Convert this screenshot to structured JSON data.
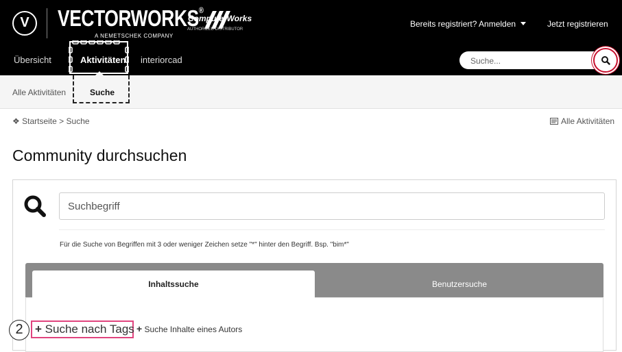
{
  "header": {
    "logo_glyph": "V",
    "brand_name": "VECTORWORKS",
    "brand_registered": "®",
    "brand_tagline": "A NEMETSCHEK COMPANY",
    "distributor_name": "ComputerWorks",
    "distributor_tagline": "AUTHORIZED DISTRIBUTOR",
    "login_label": "Bereits registriert? Anmelden",
    "register_label": "Jetzt registrieren",
    "nav": [
      {
        "label": "Übersicht"
      },
      {
        "label": "Aktivitäten",
        "active": true
      },
      {
        "label": "interiorcad"
      }
    ],
    "search_placeholder": "Suche..."
  },
  "subnav": [
    {
      "label": "Alle Aktivitäten"
    },
    {
      "label": "Suche",
      "active": true
    }
  ],
  "breadcrumb": {
    "home_icon": "home-icon",
    "home": "Startseite",
    "separator": ">",
    "current": "Suche"
  },
  "all_activities_link": "Alle Aktivitäten",
  "page_title": "Community durchsuchen",
  "search_form": {
    "term_placeholder": "Suchbegriff",
    "hint": "Für die Suche von Begriffen mit 3 oder weniger Zeichen setze \"*\" hinter den Begriff. Bsp. \"bim*\"",
    "tabs": [
      {
        "label": "Inhaltssuche",
        "active": true
      },
      {
        "label": "Benutzersuche"
      }
    ],
    "plus_glyph": "+",
    "tag_search_label": "Suche nach Tags",
    "author_search_label": "Suche Inhalte eines Autors"
  },
  "annotations": {
    "step_number": "2"
  },
  "colors": {
    "header_bg": "#000000",
    "highlight_red": "#c8102e",
    "highlight_pink": "#e0447e",
    "tab_bar_gray": "#8a8a8a"
  }
}
